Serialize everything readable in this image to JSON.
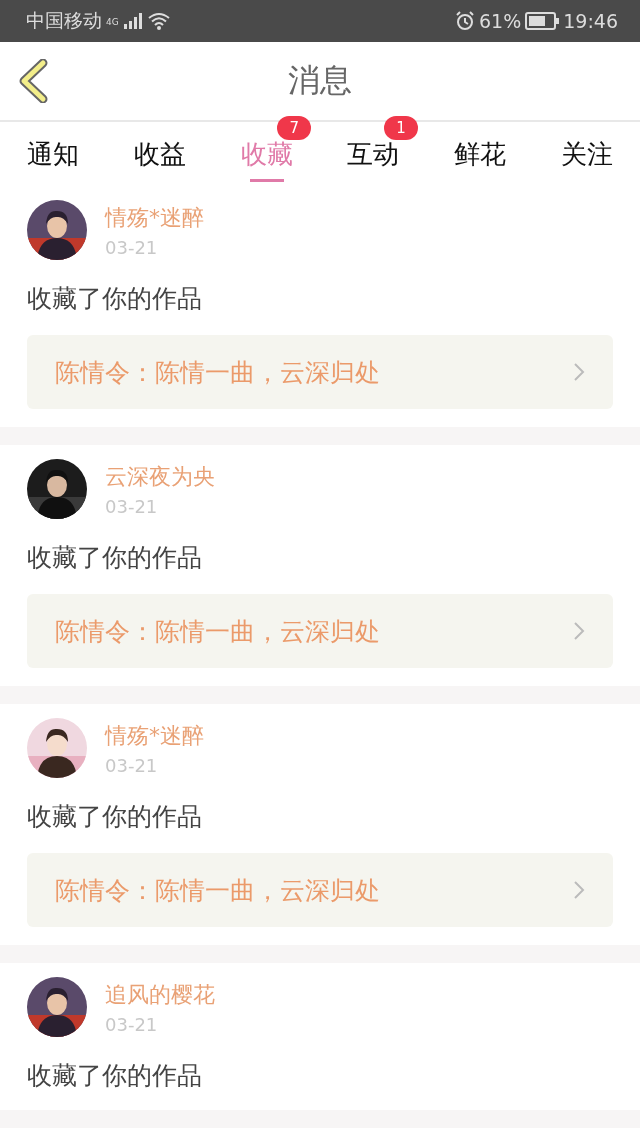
{
  "status_bar": {
    "carrier": "中国移动",
    "network": "4G",
    "battery": "61%",
    "time": "19:46"
  },
  "header": {
    "title": "消息"
  },
  "tabs": [
    {
      "label": "通知",
      "selected": false
    },
    {
      "label": "收益",
      "selected": false
    },
    {
      "label": "收藏",
      "selected": true,
      "badge": "7"
    },
    {
      "label": "互动",
      "selected": false,
      "badge": "1"
    },
    {
      "label": "鲜花",
      "selected": false
    },
    {
      "label": "关注",
      "selected": false
    }
  ],
  "messages": [
    {
      "user": "情殇*迷醉",
      "date": "03-21",
      "action": "收藏了你的作品",
      "work": "陈情令：陈情一曲，云深归处"
    },
    {
      "user": "云深夜为央",
      "date": "03-21",
      "action": "收藏了你的作品",
      "work": "陈情令：陈情一曲，云深归处"
    },
    {
      "user": "情殇*迷醉",
      "date": "03-21",
      "action": "收藏了你的作品",
      "work": "陈情令：陈情一曲，云深归处"
    },
    {
      "user": "追风的樱花",
      "date": "03-21",
      "action": "收藏了你的作品"
    }
  ]
}
